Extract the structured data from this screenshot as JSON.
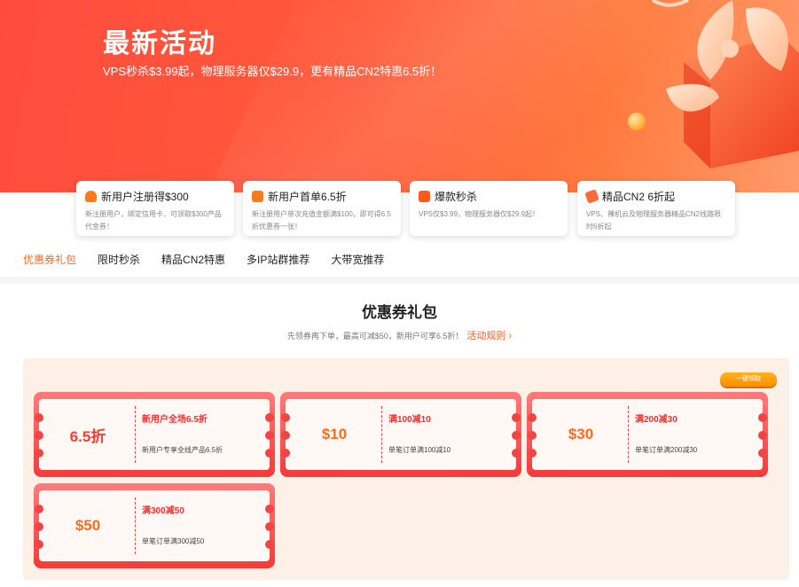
{
  "hero": {
    "title": "最新活动",
    "subtitle": "VPS秒杀$3.99起，物理服务器仅$29.9，更有精品CN2特惠6.5折！"
  },
  "features": [
    {
      "title": "新用户注册得$300",
      "desc": "新注册用户，绑定信用卡，可领取$300产品代金券！",
      "icon": "user-icon",
      "color": "#ff7a1a"
    },
    {
      "title": "新用户首单6.5折",
      "desc": "新注册用户单次充值金额满$100，即可得6.5折优惠券一张！",
      "icon": "gift-icon",
      "color": "#ff7a1a"
    },
    {
      "title": "爆款秒杀",
      "desc": "VPS仅$3.99，物理服务器仅$29.9起！",
      "icon": "cart-icon",
      "color": "#ff5a1a"
    },
    {
      "title": "精品CN2 6折起",
      "desc": "VPS、裸机云及物理服务器精品CN2线路限时6折起",
      "icon": "tag-icon",
      "color": "#ff6a3a"
    }
  ],
  "tabs": [
    "优惠券礼包",
    "限时秒杀",
    "精品CN2特惠",
    "多IP站群推荐",
    "大带宽推荐"
  ],
  "section": {
    "title": "优惠券礼包",
    "subtitle": "先领券再下单，最高可减$50，新用户可享6.5折！",
    "rules_link": "活动规则 ›",
    "claim_all": "一键领取"
  },
  "coupons": [
    {
      "amount": "6.5折",
      "title": "新用户全场6.5折",
      "desc": "新用户专享全线产品6.5折",
      "accent": "red"
    },
    {
      "amount": "$10",
      "title": "满100减10",
      "desc": "单笔订单满100减10",
      "accent": "orange"
    },
    {
      "amount": "$30",
      "title": "满200减30",
      "desc": "单笔订单满200减30",
      "accent": "orange"
    },
    {
      "amount": "$50",
      "title": "满300减50",
      "desc": "单笔订单满300减50",
      "accent": "orange"
    }
  ],
  "colors": {
    "brand": "#ff5a3a",
    "tab_active": "#ff6a1a",
    "coupon_border": "#f53a3a"
  }
}
